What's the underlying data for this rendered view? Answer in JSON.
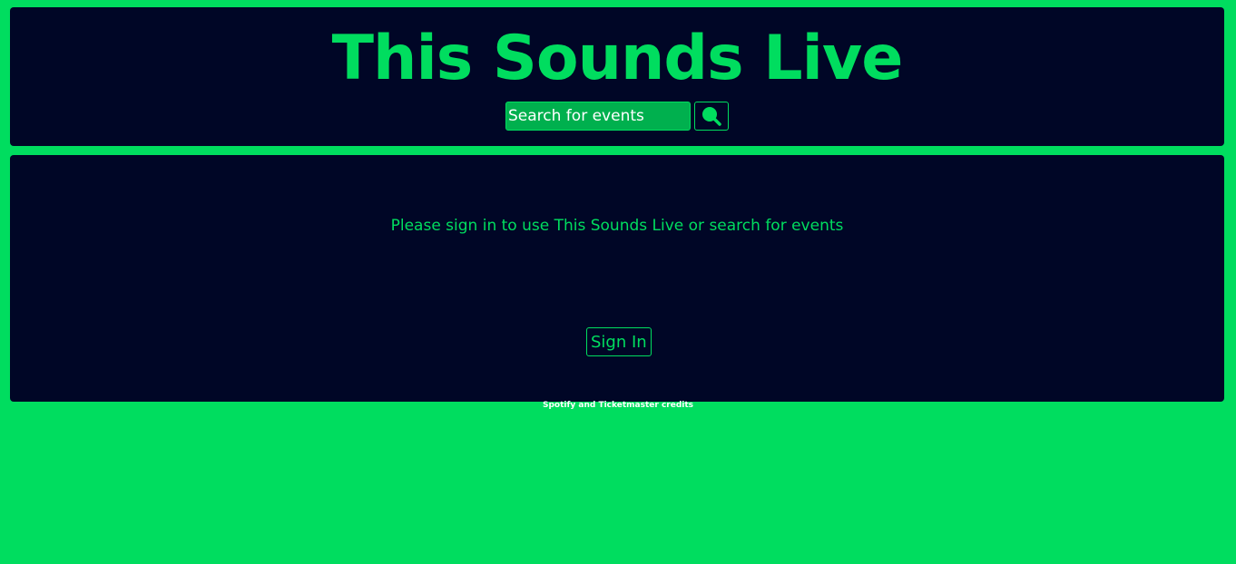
{
  "header": {
    "title": "This Sounds Live",
    "search": {
      "placeholder": "Search for events",
      "button_icon": "search-icon"
    }
  },
  "main": {
    "message": "Please sign in to use This Sounds Live or search for events",
    "signin_label": "Sign In"
  },
  "footer": {
    "credits": "Spotify and Ticketmaster credits"
  },
  "colors": {
    "background": "#00dd5f",
    "panel": "#000626",
    "accent": "#00dd5f",
    "input_fill": "#00b04e",
    "text_light": "#ffffff"
  }
}
